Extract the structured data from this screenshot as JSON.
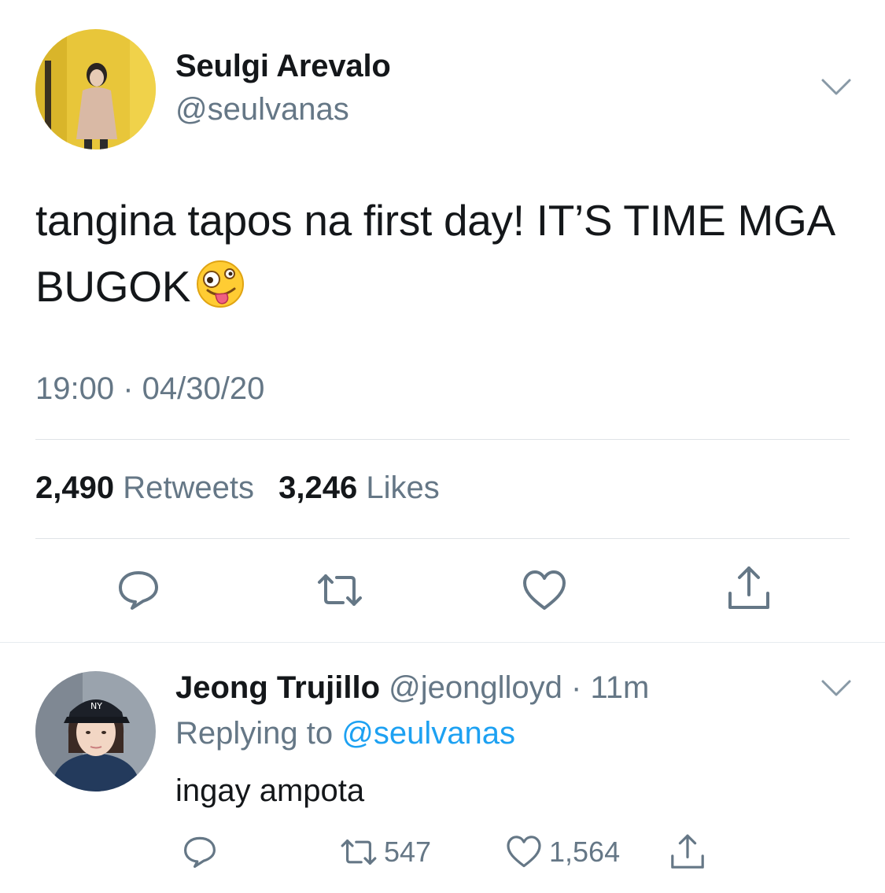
{
  "main_tweet": {
    "author_name": "Seulgi Arevalo",
    "author_handle": "@seulvanas",
    "text": "tangina tapos na first day! IT’S TIME MGA BUGOK",
    "emoji": "zany-face",
    "timestamp": "19:00 · 04/30/20",
    "retweet_count": "2,490",
    "retweet_label": "Retweets",
    "like_count": "3,246",
    "like_label": "Likes",
    "actions": [
      "reply-icon",
      "retweet-icon",
      "like-icon",
      "share-icon"
    ]
  },
  "reply": {
    "author_name": "Jeong Trujillo",
    "author_handle": "@jeonglloyd",
    "time": "· 11m",
    "replying_label": "Replying to",
    "replying_to": "@seulvanas",
    "text": "ingay ampota",
    "retweet_count": "547",
    "like_count": "1,564"
  },
  "colors": {
    "text_primary": "#14171a",
    "text_secondary": "#657786",
    "link": "#1da1f2",
    "divider": "#dfe3e7"
  }
}
